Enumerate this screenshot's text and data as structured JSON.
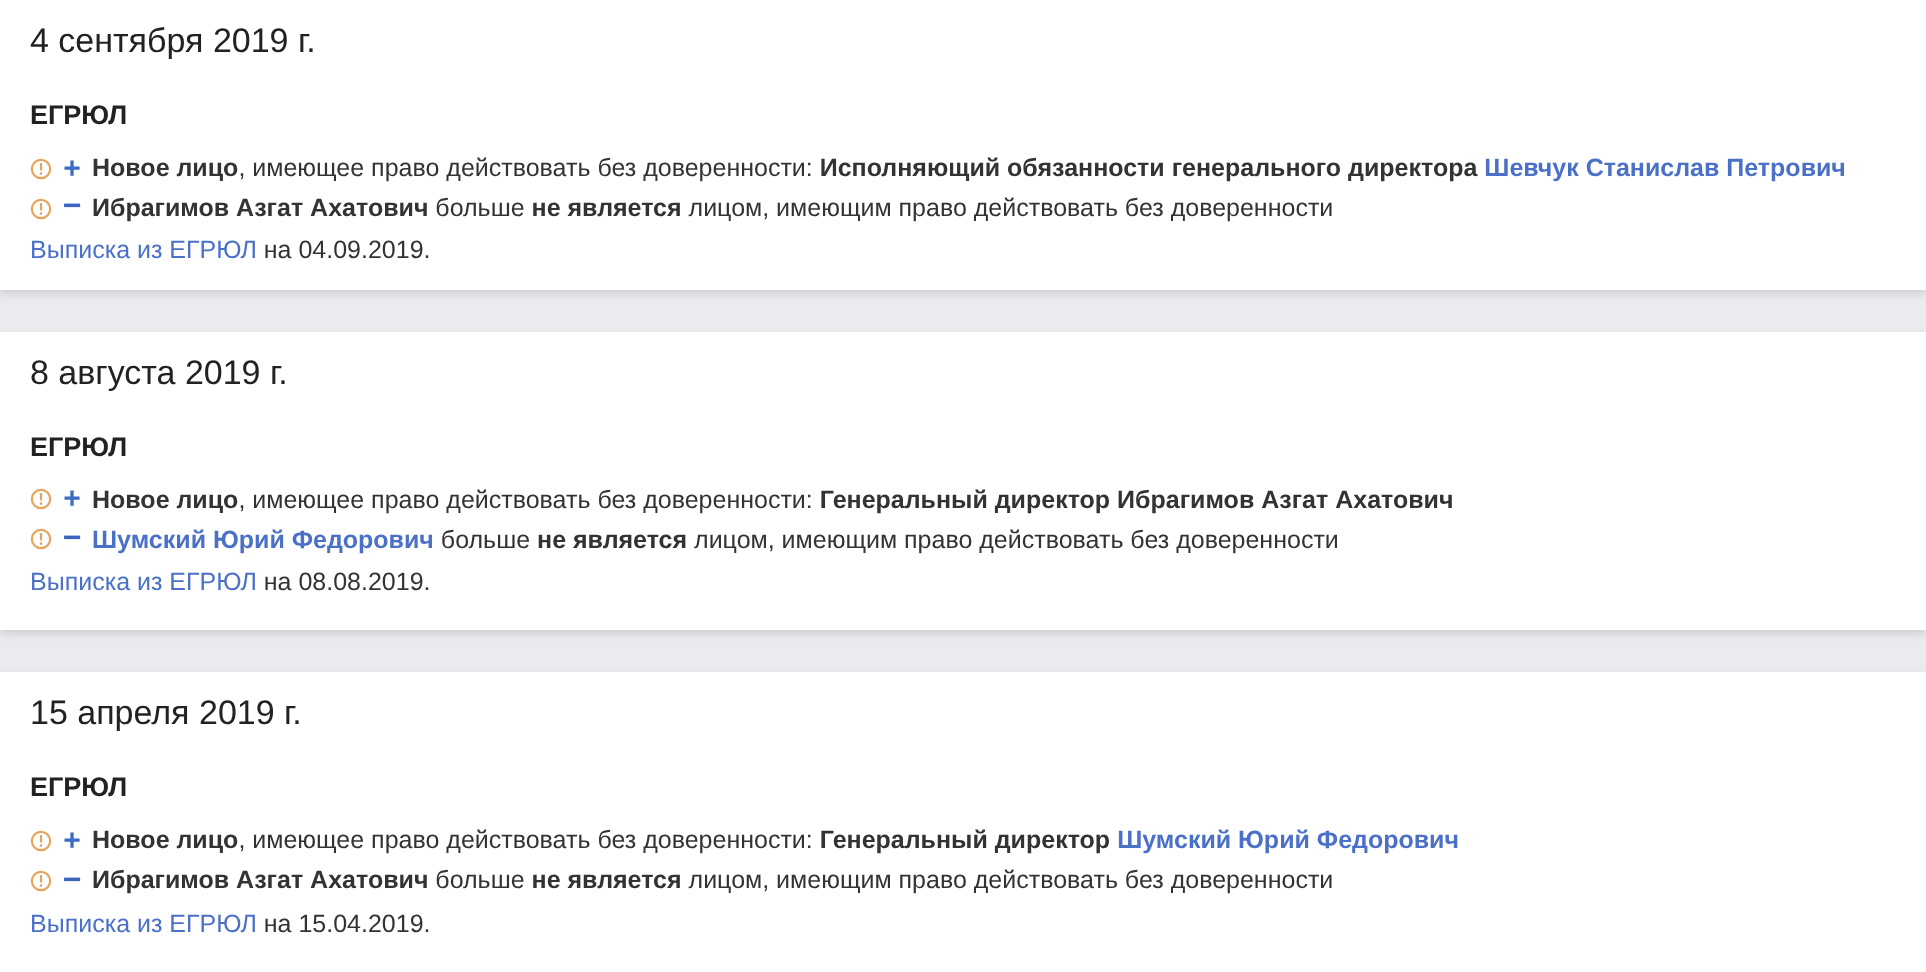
{
  "events": [
    {
      "date": "4 сентября 2019 г.",
      "source": "ЕГРЮЛ",
      "changes": [
        {
          "kind": "added",
          "sign": "+",
          "segments": [
            {
              "kind": "text",
              "text": "**Новое лицо**, имеющее право действовать без доверенности: **Исполняющий обязанности генерального директора**"
            },
            {
              "kind": "link",
              "text": "Шевчук Станислав Петрович"
            }
          ]
        },
        {
          "kind": "removed",
          "sign": "−",
          "segments": [
            {
              "kind": "text",
              "text": "**Ибрагимов Азгат Ахатович** больше **не является** лицом, имеющим право действовать без доверенности"
            }
          ]
        }
      ],
      "extract": {
        "link": "Выписка из ЕГРЮЛ",
        "suffix": "на 04.09.2019."
      }
    },
    {
      "date": "8 августа 2019 г.",
      "source": "ЕГРЮЛ",
      "changes": [
        {
          "kind": "added",
          "sign": "+",
          "segments": [
            {
              "kind": "text",
              "text": "**Новое лицо**, имеющее право действовать без доверенности: **Генеральный директор Ибрагимов Азгат Ахатович**"
            }
          ]
        },
        {
          "kind": "removed",
          "sign": "−",
          "segments": [
            {
              "kind": "link",
              "text": "Шумский Юрий Федорович"
            },
            {
              "kind": "text",
              "text": "больше **не является** лицом, имеющим право действовать без доверенности"
            }
          ]
        }
      ],
      "extract": {
        "link": "Выписка из ЕГРЮЛ",
        "suffix": "на 08.08.2019."
      }
    },
    {
      "date": "15 апреля 2019 г.",
      "source": "ЕГРЮЛ",
      "changes": [
        {
          "kind": "added",
          "sign": "+",
          "segments": [
            {
              "kind": "text",
              "text": "**Новое лицо**, имеющее право действовать без доверенности: **Генеральный директор**"
            },
            {
              "kind": "link",
              "text": "Шумский Юрий Федорович"
            }
          ]
        },
        {
          "kind": "removed",
          "sign": "−",
          "segments": [
            {
              "kind": "text",
              "text": "**Ибрагимов Азгат Ахатович** больше **не является** лицом, имеющим право действовать без доверенности"
            }
          ]
        }
      ],
      "extract": {
        "link": "Выписка из ЕГРЮЛ",
        "suffix": "на 15.04.2019."
      }
    }
  ]
}
